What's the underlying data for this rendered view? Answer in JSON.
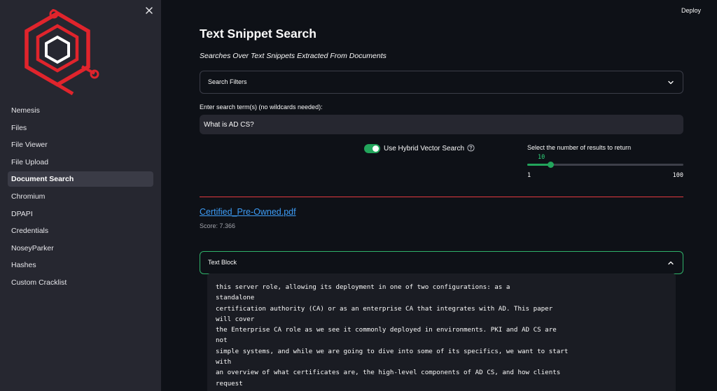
{
  "sidebar": {
    "items": [
      {
        "label": "Nemesis",
        "active": false
      },
      {
        "label": "Files",
        "active": false
      },
      {
        "label": "File Viewer",
        "active": false
      },
      {
        "label": "File Upload",
        "active": false
      },
      {
        "label": "Document Search",
        "active": true
      },
      {
        "label": "Chromium",
        "active": false
      },
      {
        "label": "DPAPI",
        "active": false
      },
      {
        "label": "Credentials",
        "active": false
      },
      {
        "label": "NoseyParker",
        "active": false
      },
      {
        "label": "Hashes",
        "active": false
      },
      {
        "label": "Custom Cracklist",
        "active": false
      }
    ]
  },
  "header": {
    "deploy_label": "Deploy"
  },
  "main": {
    "title": "Text Snippet Search",
    "subtitle": "Searches Over Text Snippets Extracted From Documents",
    "filters_label": "Search Filters",
    "search_label": "Enter search term(s) (no wildcards needed):",
    "search_value": "What is AD CS?",
    "hybrid_label": "Use Hybrid Vector Search",
    "hybrid_on": true,
    "slider": {
      "label": "Select the number of results to return",
      "value": 10,
      "min": 1,
      "max": 100,
      "value_text": "10",
      "min_text": "1",
      "max_text": "100"
    },
    "result": {
      "filename": "Certified_Pre-Owned.pdf",
      "score": "Score: 7.366",
      "block_label": "Text Block",
      "lines": [
        "this server role, allowing its deployment in one of two configurations: as a",
        "standalone",
        "certification authority (CA) or as an enterprise CA that integrates with AD. This paper",
        "will cover",
        "the Enterprise CA role as we see it commonly deployed in environments. PKI and AD CS are",
        "not",
        "simple systems, and while we are going to dive into some of its specifics, we want to start",
        "with",
        "an overview of what certificates are, the high-level components of AD CS, and how clients",
        "request"
      ]
    }
  },
  "colors": {
    "accent_green": "#22a55b",
    "divider_red": "#e5393f",
    "link_blue": "#3d9cf5",
    "logo_red": "#e0242c"
  }
}
